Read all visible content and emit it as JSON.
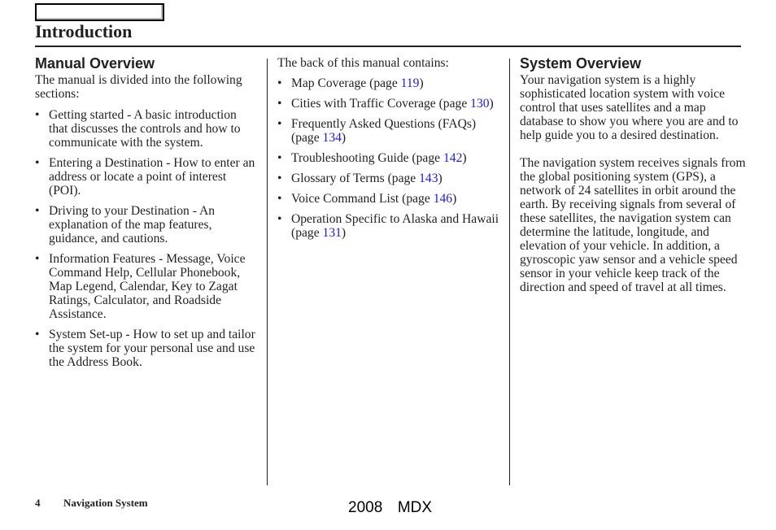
{
  "header": {
    "title": "Introduction"
  },
  "manual_overview": {
    "heading": "Manual Overview",
    "intro": "The manual is divided into the following sections:",
    "items": [
      "Getting started - A basic introduction that discusses the controls and how to communicate with the system.",
      "Entering a Destination - How to enter an address or locate a point of interest (POI).",
      "Driving to your Destination - An explanation of the map features, guidance, and cautions.",
      "Information Features - Message, Voice Command Help, Cellular Phonebook, Map Legend, Calendar, Key to Zagat Ratings, Calculator, and Roadside Assistance.",
      "System Set-up - How to set up and tailor the system for your personal use and use the Address Book."
    ]
  },
  "back_of_manual": {
    "intro": "The back of this manual contains:",
    "items": [
      {
        "label": "Map Coverage (page ",
        "page": "119",
        "suffix": ")"
      },
      {
        "label": "Cities with Traffic Coverage (page ",
        "page": "130",
        "suffix": ")"
      },
      {
        "label": "Frequently Asked Questions (FAQs) (page ",
        "page": "134",
        "suffix": ")"
      },
      {
        "label": "Troubleshooting Guide (page ",
        "page": "142",
        "suffix": ")"
      },
      {
        "label": "Glossary of Terms (page ",
        "page": "143",
        "suffix": ")"
      },
      {
        "label": "Voice Command List (page ",
        "page": "146",
        "suffix": ")"
      },
      {
        "label": "Operation Specific to Alaska and Hawaii (page ",
        "page": "131",
        "suffix": ")"
      }
    ]
  },
  "system_overview": {
    "heading": "System Overview",
    "paragraphs": [
      "Your navigation system is a highly sophisticated location system with voice control that uses satellites and a map database to show you where you are and to help guide you to a desired destination.",
      "The navigation system receives signals from the global positioning system (GPS), a network of 24 satellites in orbit around the earth. By receiving signals from several of these satellites, the navigation system can determine the latitude, longitude, and elevation of your vehicle. In addition, a gyroscopic yaw sensor and a vehicle speed sensor in your vehicle keep track of the direction and speed of travel at all times."
    ]
  },
  "footer": {
    "page_number": "4",
    "section": "Navigation System",
    "model": "2008  MDX"
  },
  "colors": {
    "link": "#1a1ae6",
    "text": "#231f20"
  }
}
